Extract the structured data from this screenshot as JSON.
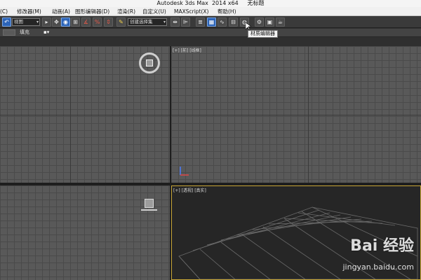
{
  "window": {
    "title": "Autodesk 3ds Max  2014 x64     无标题"
  },
  "menu": {
    "items": [
      "(C)",
      "修改器(M)",
      "动画(A)",
      "图形编辑器(D)",
      "渲染(R)",
      "自定义(U)",
      "MAXScript(X)",
      "帮助(H)"
    ]
  },
  "toolbar": {
    "selection_filter": "视图",
    "named_selection": "创建选择集",
    "tooltip": "材质编辑器",
    "icons": [
      "undo-icon",
      "select-move-icon",
      "select-rotate-icon",
      "selection-filter-icon",
      "angle-snap-icon",
      "percent-snap-icon",
      "spinner-snap-icon",
      "edit-named-sets-icon",
      "mirror-icon",
      "align-icon",
      "layer-manager-icon",
      "graphite-icon",
      "curve-editor-icon",
      "schematic-view-icon",
      "material-editor-icon",
      "render-setup-icon",
      "rendered-frame-icon",
      "render-icon",
      "teapot-icon"
    ],
    "accent": "#2c64b8"
  },
  "ribbon": {
    "label": "填充"
  },
  "viewports": {
    "top_right_label": "[+] [前] [线框]",
    "bottom_right_label": "[+] [透视] [真实]",
    "active_border": "#c8a636"
  },
  "watermark": {
    "logo": "Bai 经验",
    "url": "jingyan.baidu.com"
  }
}
